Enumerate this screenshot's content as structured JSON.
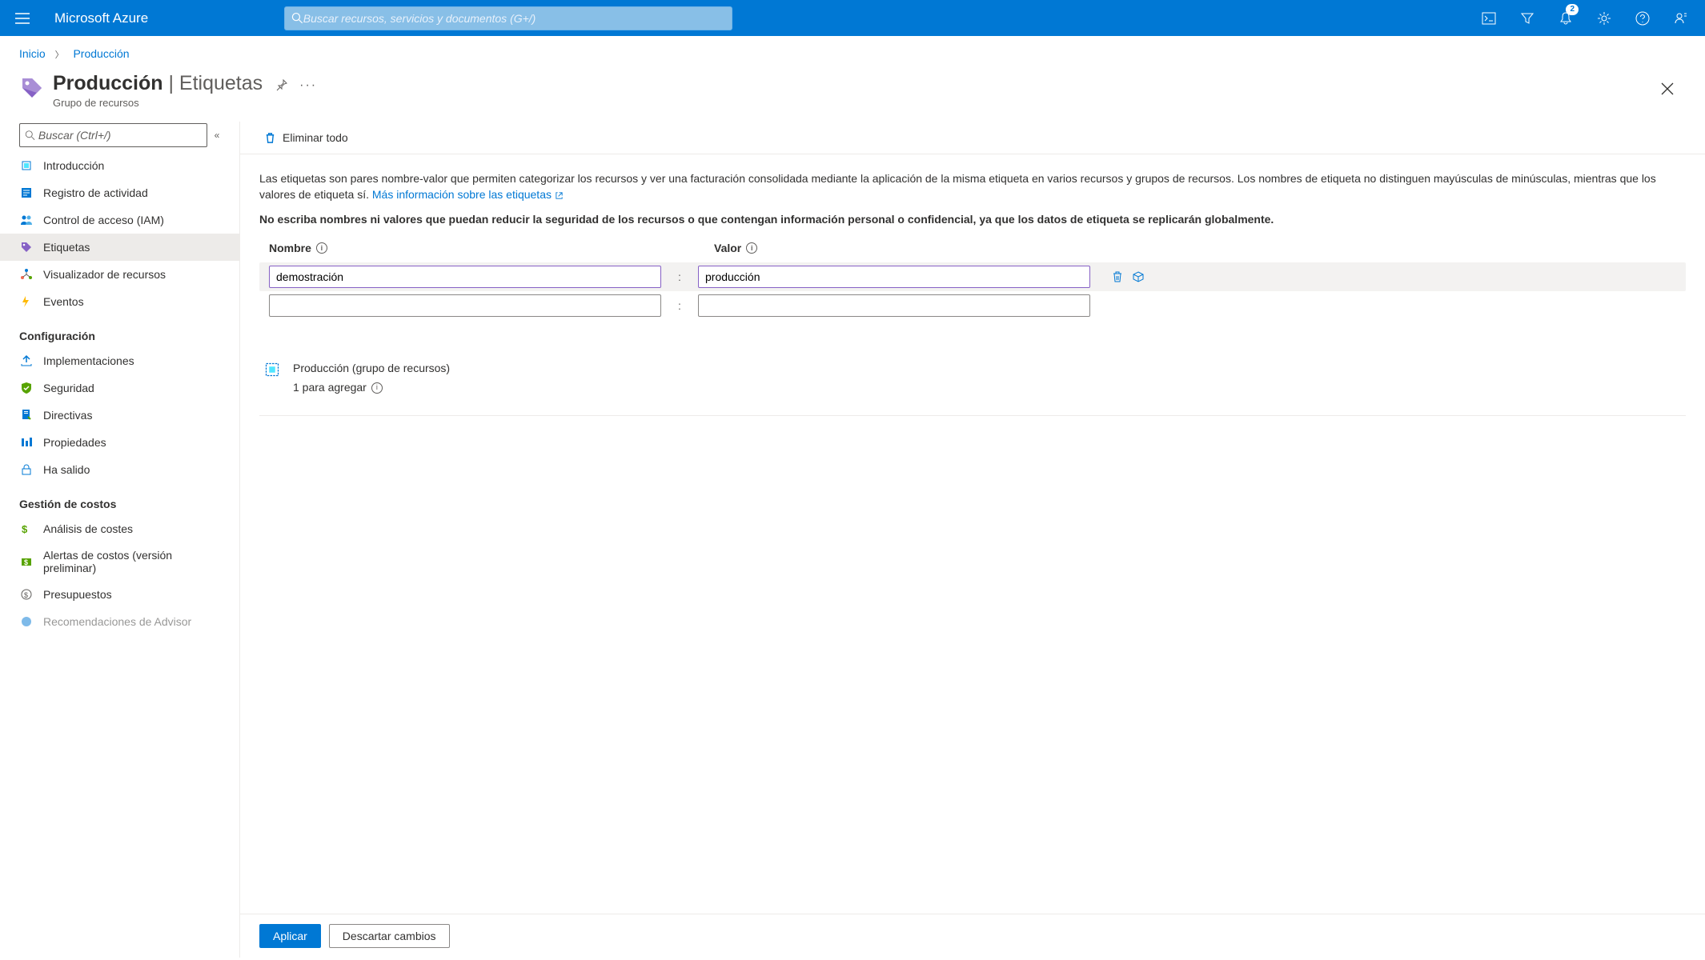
{
  "brand": "Microsoft Azure",
  "search_placeholder": "Buscar recursos, servicios y documentos (G+/)",
  "notification_count": "2",
  "breadcrumb": {
    "home": "Inicio",
    "current": "Producción"
  },
  "page": {
    "title": "Producción",
    "suffix": " | Etiquetas",
    "subtitle": "Grupo de recursos"
  },
  "sidebar": {
    "search_placeholder": "Buscar (Ctrl+/)",
    "items_main": [
      "Introducción",
      "Registro de actividad",
      "Control de acceso (IAM)",
      "Etiquetas",
      "Visualizador de recursos",
      "Eventos"
    ],
    "section_config": "Configuración",
    "items_config": [
      "Implementaciones",
      "Seguridad",
      "Directivas",
      "Propiedades",
      "Ha salido"
    ],
    "section_cost": "Gestión de costos",
    "items_cost": [
      "Análisis de costes",
      "Alertas de costos (versión preliminar)",
      "Presupuestos",
      "Recomendaciones de Advisor"
    ]
  },
  "toolbar": {
    "delete_all": "Eliminar todo"
  },
  "intro": {
    "text": "Las etiquetas son pares nombre-valor que permiten categorizar los recursos y ver una facturación consolidada mediante la aplicación de la misma etiqueta en varios recursos y grupos de recursos. Los nombres de etiqueta no distinguen mayúsculas de minúsculas, mientras que los valores de etiqueta sí. ",
    "link": "Más información sobre las etiquetas",
    "warning": "No escriba nombres ni valores que puedan reducir la seguridad de los recursos o que contengan información personal o confidencial, ya que los datos de etiqueta se replicarán globalmente."
  },
  "columns": {
    "name": "Nombre",
    "value": "Valor"
  },
  "tags": [
    {
      "name": "demostración",
      "value": "producción"
    },
    {
      "name": "",
      "value": ""
    }
  ],
  "resource": {
    "title": "Producción (grupo de recursos)",
    "subtitle": "1 para agregar"
  },
  "footer": {
    "apply": "Aplicar",
    "discard": "Descartar cambios"
  }
}
